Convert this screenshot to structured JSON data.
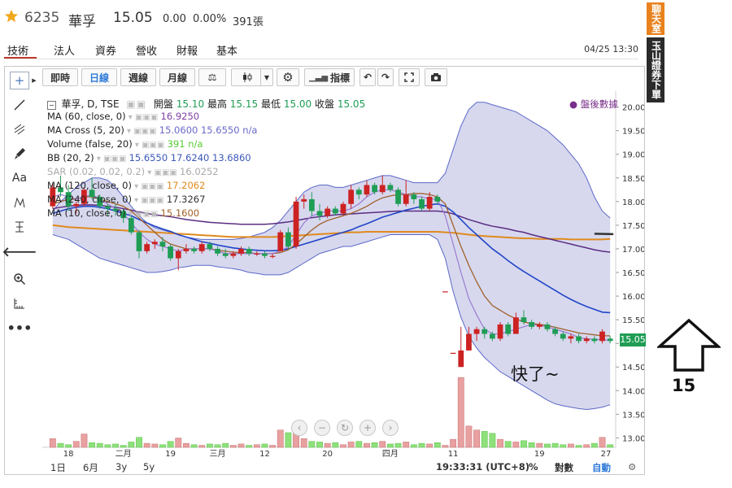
{
  "quote": {
    "code": "6235",
    "name": "華孚",
    "price": "15.05",
    "change": "0.00",
    "change_pct": "0.00%",
    "volume": "391張"
  },
  "nav": {
    "tabs": [
      "技術",
      "法人",
      "資券",
      "營收",
      "財報",
      "基本"
    ],
    "active_tab": 0,
    "datetime": "04/25 13:30"
  },
  "toolbar": {
    "intraday": "即時",
    "daily": "日線",
    "weekly": "週線",
    "monthly": "月線",
    "indicators": "指標"
  },
  "legend": {
    "main_title": "華孚, D, TSE",
    "open_label": "開盤",
    "open": "15.10",
    "high_label": "最高",
    "high": "15.15",
    "low_label": "最低",
    "low": "15.00",
    "close_label": "收盤",
    "close": "15.05",
    "after_hours": "● 盤後數據",
    "indicators": [
      {
        "name": "MA (60, close, 0)",
        "values": [
          "16.9250"
        ],
        "color": "#7b3fa0",
        "muted": false
      },
      {
        "name": "MA Cross (5, 20)",
        "values": [
          "15.0600",
          "15.6550",
          "n/a"
        ],
        "color": "#6a6ac8",
        "muted": false
      },
      {
        "name": "Volume (false, 20)",
        "values": [
          "391",
          "n/a"
        ],
        "color": "#55cc33",
        "muted": false
      },
      {
        "name": "BB (20, 2)",
        "values": [
          "15.6550",
          "17.6240",
          "13.6860"
        ],
        "color": "#3b58b8",
        "muted": false
      },
      {
        "name": "SAR (0.02, 0.02, 0.2)",
        "values": [
          "16.0252"
        ],
        "color": "#888888",
        "muted": true
      },
      {
        "name": "MA (120, close, 0)",
        "values": [
          "17.2062"
        ],
        "color": "#e08a1e",
        "muted": false
      },
      {
        "name": "MA (240, close, 0)",
        "values": [
          "17.3267"
        ],
        "color": "#333333",
        "muted": false
      },
      {
        "name": "MA (10, close, 0)",
        "values": [
          "15.1600"
        ],
        "color": "#a0602a",
        "muted": false
      }
    ]
  },
  "bottom": {
    "ranges": [
      "1日",
      "6月",
      "3y",
      "5y"
    ],
    "clock": "19:33:31 (UTC+8)",
    "pct": "%",
    "log": "對數",
    "auto": "自動"
  },
  "side": {
    "chat": "聊天室",
    "broker": "玉山證券下單"
  },
  "annotation": {
    "text": "快了~",
    "number": "15"
  },
  "colors": {
    "up": "#cc2222",
    "down": "#1f9d55",
    "bb_fill": "#c9cbe8",
    "accent": "#2f7ad8",
    "tab_underline": "#c0392b"
  },
  "chart_data": {
    "type": "candlestick",
    "x_tick_labels": [
      "18",
      "二月",
      "19",
      "三月",
      "12",
      "20",
      "四月",
      "11",
      "19",
      "27"
    ],
    "ylim": [
      12.8,
      20.2
    ],
    "y_ticks": [
      "20.00",
      "19.50",
      "19.00",
      "18.50",
      "18.00",
      "17.50",
      "17.00",
      "16.50",
      "16.00",
      "15.50",
      "15.00",
      "14.50",
      "14.00",
      "13.50",
      "13.00"
    ],
    "last_price_label": "15.05",
    "candles": [
      [
        17.9,
        18.4,
        17.85,
        18.3
      ],
      [
        18.3,
        18.55,
        18.1,
        18.2
      ],
      [
        18.2,
        18.35,
        17.8,
        17.9
      ],
      [
        17.9,
        18.0,
        17.75,
        17.95
      ],
      [
        17.95,
        18.3,
        17.9,
        18.25
      ],
      [
        18.25,
        18.5,
        18.05,
        18.1
      ],
      [
        18.1,
        18.15,
        17.85,
        17.9
      ],
      [
        17.9,
        17.95,
        17.7,
        17.85
      ],
      [
        17.85,
        17.95,
        17.7,
        17.8
      ],
      [
        17.8,
        17.85,
        17.55,
        17.65
      ],
      [
        17.65,
        17.7,
        17.3,
        17.35
      ],
      [
        17.35,
        17.4,
        16.8,
        16.95
      ],
      [
        16.95,
        17.15,
        16.9,
        17.1
      ],
      [
        17.1,
        17.2,
        17.0,
        17.15
      ],
      [
        17.15,
        17.25,
        16.95,
        17.05
      ],
      [
        17.05,
        17.1,
        16.75,
        16.8
      ],
      [
        16.8,
        17.0,
        16.55,
        16.95
      ],
      [
        16.95,
        17.1,
        16.9,
        17.0
      ],
      [
        17.0,
        17.05,
        16.9,
        16.95
      ],
      [
        16.95,
        17.15,
        16.9,
        17.1
      ],
      [
        17.1,
        17.15,
        16.95,
        17.0
      ],
      [
        17.0,
        17.05,
        16.85,
        16.9
      ],
      [
        16.9,
        17.0,
        16.8,
        16.85
      ],
      [
        16.85,
        16.95,
        16.8,
        16.9
      ],
      [
        16.9,
        17.05,
        16.85,
        17.0
      ],
      [
        17.0,
        17.05,
        16.85,
        16.9
      ],
      [
        16.9,
        16.95,
        16.85,
        16.9
      ],
      [
        16.9,
        16.95,
        16.8,
        16.85
      ],
      [
        16.85,
        16.9,
        16.8,
        16.85
      ],
      [
        16.95,
        17.4,
        16.95,
        17.35
      ],
      [
        17.35,
        17.45,
        17.0,
        17.05
      ],
      [
        17.05,
        18.1,
        17.0,
        18.0
      ],
      [
        18.0,
        18.15,
        17.85,
        18.05
      ],
      [
        18.05,
        18.2,
        17.7,
        17.8
      ],
      [
        17.8,
        17.95,
        17.6,
        17.7
      ],
      [
        17.7,
        17.9,
        17.65,
        17.85
      ],
      [
        17.85,
        17.9,
        17.7,
        17.75
      ],
      [
        17.75,
        18.0,
        17.7,
        17.95
      ],
      [
        17.95,
        18.35,
        17.85,
        18.25
      ],
      [
        18.25,
        18.3,
        18.05,
        18.15
      ],
      [
        18.15,
        18.45,
        18.1,
        18.35
      ],
      [
        18.35,
        18.4,
        18.15,
        18.2
      ],
      [
        18.2,
        18.55,
        18.15,
        18.35
      ],
      [
        18.35,
        18.4,
        18.2,
        18.25
      ],
      [
        18.25,
        18.3,
        17.9,
        17.95
      ],
      [
        17.95,
        18.45,
        17.9,
        18.15
      ],
      [
        18.15,
        18.2,
        17.95,
        18.05
      ],
      [
        18.05,
        18.1,
        17.8,
        17.85
      ],
      [
        17.85,
        18.2,
        17.8,
        18.1
      ],
      [
        18.1,
        18.15,
        17.95,
        18.0
      ],
      [
        16.1,
        16.1,
        16.1,
        16.1
      ],
      [
        14.8,
        14.8,
        14.8,
        14.8
      ],
      [
        14.5,
        15.35,
        14.5,
        14.85
      ],
      [
        14.85,
        15.35,
        14.85,
        15.2
      ],
      [
        15.2,
        15.35,
        15.05,
        15.3
      ],
      [
        15.3,
        15.35,
        15.1,
        15.2
      ],
      [
        15.2,
        15.25,
        15.05,
        15.1
      ],
      [
        15.1,
        15.45,
        15.05,
        15.4
      ],
      [
        15.4,
        15.45,
        15.15,
        15.2
      ],
      [
        15.2,
        15.65,
        15.2,
        15.55
      ],
      [
        15.55,
        15.7,
        15.4,
        15.45
      ],
      [
        15.45,
        15.5,
        15.3,
        15.35
      ],
      [
        15.35,
        15.45,
        15.3,
        15.4
      ],
      [
        15.4,
        15.45,
        15.25,
        15.3
      ],
      [
        15.3,
        15.35,
        15.15,
        15.2
      ],
      [
        15.2,
        15.25,
        15.05,
        15.1
      ],
      [
        15.1,
        15.2,
        15.0,
        15.15
      ],
      [
        15.15,
        15.2,
        15.0,
        15.05
      ],
      [
        15.05,
        15.15,
        15.0,
        15.1
      ],
      [
        15.1,
        15.15,
        15.0,
        15.05
      ],
      [
        15.05,
        15.3,
        15.0,
        15.25
      ],
      [
        15.1,
        15.15,
        15.0,
        15.05
      ]
    ],
    "volume": [
      130,
      60,
      40,
      90,
      200,
      70,
      60,
      40,
      50,
      30,
      80,
      150,
      60,
      50,
      40,
      90,
      140,
      60,
      40,
      30,
      50,
      40,
      60,
      30,
      50,
      30,
      40,
      50,
      30,
      260,
      220,
      320,
      130,
      90,
      80,
      60,
      70,
      40,
      80,
      90,
      60,
      70,
      90,
      50,
      60,
      80,
      40,
      60,
      50,
      70,
      30,
      120,
      1050,
      320,
      260,
      240,
      210,
      120,
      90,
      80,
      100,
      70,
      60,
      50,
      60,
      40,
      50,
      30,
      40,
      60,
      150,
      39
    ],
    "volume_max": 1100,
    "bb_upper": [
      17.8,
      18.0,
      18.15,
      18.3,
      18.4,
      18.5,
      18.5,
      18.45,
      18.3,
      18.1,
      17.9,
      17.7,
      17.55,
      17.45,
      17.4,
      17.35,
      17.3,
      17.25,
      17.22,
      17.2,
      17.2,
      17.2,
      17.2,
      17.2,
      17.22,
      17.25,
      17.3,
      17.35,
      17.45,
      17.6,
      17.8,
      18.0,
      18.2,
      18.3,
      18.35,
      18.35,
      18.3,
      18.3,
      18.35,
      18.4,
      18.45,
      18.5,
      18.55,
      18.55,
      18.5,
      18.45,
      18.4,
      18.4,
      18.4,
      18.4,
      18.6,
      19.1,
      19.6,
      19.95,
      20.1,
      20.1,
      20.05,
      20.0,
      19.95,
      19.9,
      19.8,
      19.7,
      19.6,
      19.5,
      19.35,
      19.2,
      19.0,
      18.8,
      18.5,
      18.1,
      17.8,
      17.65
    ],
    "bb_lower": [
      17.3,
      17.25,
      17.2,
      17.1,
      17.0,
      16.9,
      16.8,
      16.75,
      16.7,
      16.65,
      16.6,
      16.55,
      16.5,
      16.5,
      16.52,
      16.55,
      16.6,
      16.62,
      16.65,
      16.65,
      16.65,
      16.62,
      16.6,
      16.58,
      16.55,
      16.5,
      16.48,
      16.45,
      16.45,
      16.45,
      16.5,
      16.6,
      16.7,
      16.8,
      16.9,
      16.95,
      17.0,
      17.05,
      17.05,
      17.1,
      17.15,
      17.2,
      17.25,
      17.3,
      17.3,
      17.3,
      17.3,
      17.3,
      17.3,
      17.2,
      16.8,
      16.1,
      15.55,
      15.15,
      14.9,
      14.7,
      14.55,
      14.4,
      14.3,
      14.2,
      14.1,
      14.0,
      13.9,
      13.8,
      13.72,
      13.68,
      13.65,
      13.62,
      13.6,
      13.62,
      13.65,
      13.7
    ],
    "ma_cross_5": [
      18.1,
      18.15,
      18.1,
      18.05,
      18.1,
      18.15,
      18.05,
      17.95,
      17.85,
      17.75,
      17.55,
      17.35,
      17.2,
      17.1,
      17.05,
      17.0,
      16.95,
      17.0,
      17.0,
      17.0,
      17.0,
      16.95,
      16.9,
      16.9,
      16.9,
      16.9,
      16.9,
      16.9,
      16.9,
      16.95,
      17.05,
      17.3,
      17.55,
      17.7,
      17.75,
      17.8,
      17.8,
      17.8,
      17.85,
      17.95,
      18.1,
      18.2,
      18.25,
      18.25,
      18.2,
      18.15,
      18.1,
      18.1,
      18.05,
      18.05,
      17.7,
      17.1,
      16.5,
      15.95,
      15.6,
      15.3,
      15.2,
      15.2,
      15.25,
      15.3,
      15.35,
      15.4,
      15.38,
      15.35,
      15.3,
      15.25,
      15.2,
      15.12,
      15.1,
      15.08,
      15.08,
      15.06
    ],
    "ma_10": [
      17.95,
      18.0,
      18.05,
      18.05,
      18.1,
      18.1,
      18.05,
      18.0,
      17.95,
      17.9,
      17.8,
      17.65,
      17.5,
      17.35,
      17.2,
      17.1,
      17.05,
      17.0,
      17.0,
      17.0,
      17.0,
      16.97,
      16.95,
      16.93,
      16.92,
      16.92,
      16.9,
      16.9,
      16.9,
      16.92,
      16.98,
      17.1,
      17.25,
      17.4,
      17.52,
      17.6,
      17.65,
      17.7,
      17.75,
      17.82,
      17.9,
      18.0,
      18.08,
      18.12,
      18.15,
      18.15,
      18.17,
      18.17,
      18.15,
      18.1,
      17.95,
      17.5,
      17.05,
      16.65,
      16.3,
      16.0,
      15.8,
      15.7,
      15.6,
      15.52,
      15.45,
      15.42,
      15.4,
      15.38,
      15.34,
      15.3,
      15.26,
      15.22,
      15.2,
      15.18,
      15.16,
      15.16
    ],
    "ma_20": [
      17.75,
      17.8,
      17.85,
      17.88,
      17.9,
      17.9,
      17.88,
      17.85,
      17.8,
      17.75,
      17.7,
      17.62,
      17.55,
      17.48,
      17.42,
      17.37,
      17.3,
      17.25,
      17.2,
      17.15,
      17.12,
      17.08,
      17.05,
      17.02,
      17.0,
      16.98,
      16.97,
      16.96,
      16.96,
      16.97,
      17.0,
      17.05,
      17.1,
      17.15,
      17.2,
      17.25,
      17.3,
      17.35,
      17.4,
      17.47,
      17.53,
      17.6,
      17.67,
      17.72,
      17.77,
      17.82,
      17.86,
      17.9,
      17.93,
      17.95,
      17.9,
      17.78,
      17.62,
      17.45,
      17.3,
      17.15,
      17.0,
      16.88,
      16.75,
      16.63,
      16.52,
      16.42,
      16.32,
      16.22,
      16.12,
      16.02,
      15.93,
      15.85,
      15.78,
      15.72,
      15.66,
      15.65
    ],
    "ma_60": [
      17.85,
      17.88,
      17.9,
      17.92,
      17.93,
      17.93,
      17.92,
      17.9,
      17.88,
      17.85,
      17.82,
      17.78,
      17.75,
      17.72,
      17.7,
      17.68,
      17.65,
      17.62,
      17.6,
      17.58,
      17.56,
      17.55,
      17.54,
      17.53,
      17.52,
      17.52,
      17.52,
      17.52,
      17.53,
      17.55,
      17.57,
      17.6,
      17.63,
      17.66,
      17.68,
      17.7,
      17.72,
      17.73,
      17.74,
      17.75,
      17.76,
      17.77,
      17.78,
      17.79,
      17.8,
      17.8,
      17.8,
      17.8,
      17.8,
      17.8,
      17.78,
      17.74,
      17.68,
      17.62,
      17.57,
      17.52,
      17.48,
      17.45,
      17.42,
      17.38,
      17.35,
      17.3,
      17.26,
      17.22,
      17.18,
      17.14,
      17.1,
      17.06,
      17.02,
      16.98,
      16.95,
      16.93
    ],
    "ma_120": [
      17.5,
      17.48,
      17.46,
      17.45,
      17.44,
      17.43,
      17.42,
      17.41,
      17.4,
      17.39,
      17.38,
      17.37,
      17.36,
      17.35,
      17.34,
      17.33,
      17.32,
      17.31,
      17.3,
      17.29,
      17.28,
      17.27,
      17.26,
      17.25,
      17.25,
      17.25,
      17.25,
      17.25,
      17.25,
      17.26,
      17.27,
      17.28,
      17.29,
      17.3,
      17.31,
      17.32,
      17.33,
      17.34,
      17.35,
      17.35,
      17.36,
      17.36,
      17.36,
      17.36,
      17.36,
      17.36,
      17.36,
      17.36,
      17.36,
      17.36,
      17.35,
      17.34,
      17.32,
      17.3,
      17.28,
      17.27,
      17.26,
      17.25,
      17.24,
      17.23,
      17.22,
      17.22,
      17.21,
      17.21,
      17.21,
      17.21,
      17.2,
      17.2,
      17.2,
      17.2,
      17.2,
      17.21
    ],
    "ma_240_tail": [
      17.32,
      17.31
    ]
  }
}
